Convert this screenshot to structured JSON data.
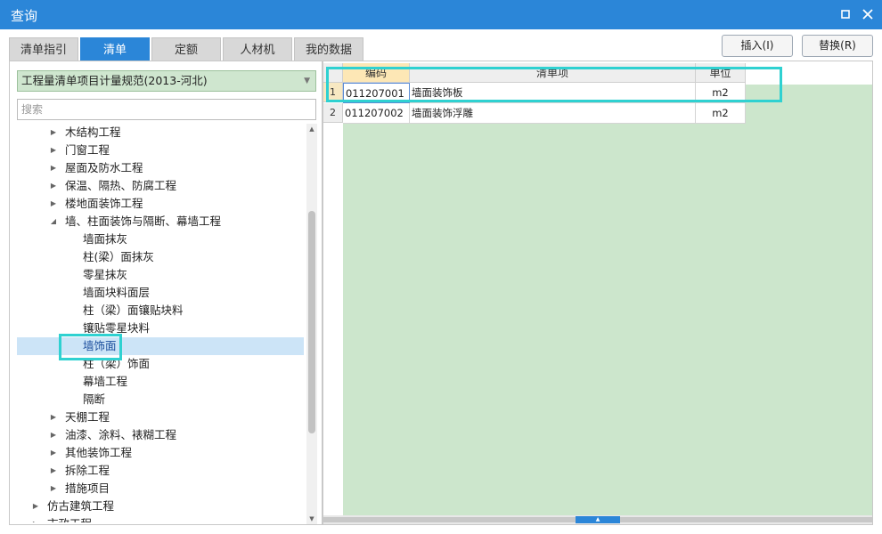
{
  "window": {
    "title": "查询",
    "maximize_icon": "maximize-icon",
    "close_icon": "close-icon"
  },
  "tabs": [
    {
      "label": "清单指引",
      "active": false
    },
    {
      "label": "清单",
      "active": true
    },
    {
      "label": "定额",
      "active": false
    },
    {
      "label": "人材机",
      "active": false
    },
    {
      "label": "我的数据",
      "active": false
    }
  ],
  "buttons": {
    "insert": "插入(I)",
    "replace": "替换(R)"
  },
  "left": {
    "standard_select": "工程量清单项目计量规范(2013-河北)",
    "search_placeholder": "搜索",
    "tree": [
      {
        "label": "木结构工程",
        "level": 1,
        "state": "collapsed"
      },
      {
        "label": "门窗工程",
        "level": 1,
        "state": "collapsed"
      },
      {
        "label": "屋面及防水工程",
        "level": 1,
        "state": "collapsed"
      },
      {
        "label": "保温、隔热、防腐工程",
        "level": 1,
        "state": "collapsed"
      },
      {
        "label": "楼地面装饰工程",
        "level": 1,
        "state": "collapsed"
      },
      {
        "label": "墙、柱面装饰与隔断、幕墙工程",
        "level": 1,
        "state": "expanded"
      },
      {
        "label": "墙面抹灰",
        "level": 2,
        "state": "leaf"
      },
      {
        "label": "柱(梁）面抹灰",
        "level": 2,
        "state": "leaf"
      },
      {
        "label": "零星抹灰",
        "level": 2,
        "state": "leaf"
      },
      {
        "label": "墙面块料面层",
        "level": 2,
        "state": "leaf"
      },
      {
        "label": "柱（梁）面镶贴块料",
        "level": 2,
        "state": "leaf"
      },
      {
        "label": "镶贴零星块料",
        "level": 2,
        "state": "leaf"
      },
      {
        "label": "墙饰面",
        "level": 2,
        "state": "leaf",
        "selected": true
      },
      {
        "label": "柱（梁）饰面",
        "level": 2,
        "state": "leaf"
      },
      {
        "label": "幕墙工程",
        "level": 2,
        "state": "leaf"
      },
      {
        "label": "隔断",
        "level": 2,
        "state": "leaf"
      },
      {
        "label": "天棚工程",
        "level": 1,
        "state": "collapsed"
      },
      {
        "label": "油漆、涂料、裱糊工程",
        "level": 1,
        "state": "collapsed"
      },
      {
        "label": "其他装饰工程",
        "level": 1,
        "state": "collapsed"
      },
      {
        "label": "拆除工程",
        "level": 1,
        "state": "collapsed"
      },
      {
        "label": "措施项目",
        "level": 1,
        "state": "collapsed"
      },
      {
        "label": "仿古建筑工程",
        "level": 0,
        "state": "collapsed"
      },
      {
        "label": "市政工程",
        "level": 0,
        "state": "collapsed"
      }
    ]
  },
  "grid": {
    "columns": [
      "编码",
      "清单项",
      "单位"
    ],
    "rows": [
      {
        "num": "1",
        "code": "011207001",
        "name": "墙面装饰板",
        "unit": "m2"
      },
      {
        "num": "2",
        "code": "011207002",
        "name": "墙面装饰浮雕",
        "unit": "m2"
      }
    ]
  },
  "colors": {
    "accent": "#2b86d8",
    "highlight": "#2fd1d1",
    "grid_background": "#cce6cc",
    "select_background": "#cfe6cf"
  }
}
